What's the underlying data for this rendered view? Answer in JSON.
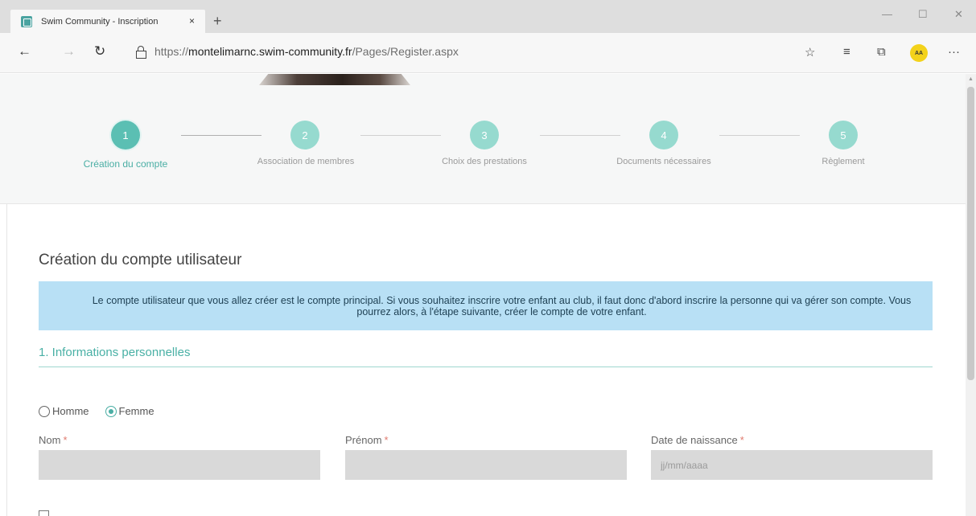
{
  "browser": {
    "tab_title": "Swim Community - Inscription",
    "tab_close": "×",
    "new_tab": "+",
    "url_prefix": "https://",
    "url_host": "montelimarnc.swim-community.fr",
    "url_path": "/Pages/Register.aspx",
    "avatar_text": "AA",
    "window_controls": {
      "minimize": "—",
      "maximize": "☐",
      "close": "✕"
    }
  },
  "stepper": {
    "steps": [
      {
        "number": "1",
        "label": "Création du compte",
        "state": "active"
      },
      {
        "number": "2",
        "label": "Association de membres",
        "state": "pending"
      },
      {
        "number": "3",
        "label": "Choix des prestations",
        "state": "pending"
      },
      {
        "number": "4",
        "label": "Documents nécessaires",
        "state": "pending"
      },
      {
        "number": "5",
        "label": "Règlement",
        "state": "pending"
      }
    ]
  },
  "form": {
    "title": "Création du compte utilisateur",
    "info_text": "Le compte utilisateur que vous allez créer est le compte principal. Si vous souhaitez inscrire votre enfant au club, il faut donc d'abord inscrire la personne qui va gérer son compte. Vous pourrez alors, à l'étape suivante, créer le compte de votre enfant.",
    "section_title": "1. Informations personnelles",
    "gender": {
      "options": [
        {
          "label": "Homme",
          "checked": false
        },
        {
          "label": "Femme",
          "checked": true
        }
      ]
    },
    "fields": {
      "nom_label": "Nom",
      "prenom_label": "Prénom",
      "dob_label": "Date de naissance",
      "required_mark": "*",
      "dob_placeholder": "jj/mm/aaaa"
    }
  },
  "colors": {
    "accent": "#4aaea4",
    "step_pending": "#96dacf",
    "info_bg": "#b8e0f5",
    "input_bg": "#d9d9d9",
    "required": "#e07a6e"
  }
}
